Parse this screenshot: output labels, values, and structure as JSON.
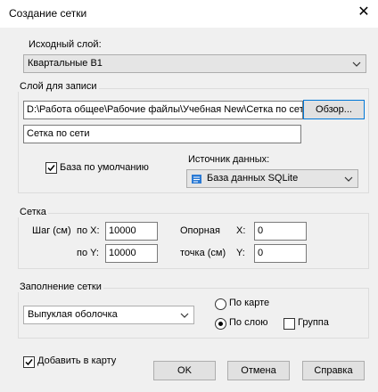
{
  "window": {
    "title": "Создание сетки",
    "close_glyph": "✕"
  },
  "source_layer": {
    "label": "Исходный слой:",
    "value": "Квартальные В1"
  },
  "write_layer": {
    "group_label": "Слой для записи",
    "path": "D:\\Работа общее\\Рабочие файлы\\Учебная New\\Сетка по сет",
    "browse_label": "Обзор...",
    "name": "Сетка по сети",
    "default_db_label": "База по умолчанию",
    "default_db_checked": true,
    "data_source_label": "Источник данных:",
    "data_source_value": "База данных SQLite",
    "data_source_icon": "database-icon"
  },
  "grid": {
    "group_label": "Сетка",
    "step_label": "Шаг (см)",
    "x_label": "по X:",
    "y_label": "по Y:",
    "step_x": "10000",
    "step_y": "10000",
    "ref_label_1": "Опорная",
    "ref_label_2": "точка (см)",
    "ref_x_label": "X:",
    "ref_y_label": "Y:",
    "ref_x": "0",
    "ref_y": "0"
  },
  "fill": {
    "group_label": "Заполнение сетки",
    "value": "Выпуклая оболочка",
    "by_map_label": "По карте",
    "by_layer_label": "По слою",
    "group_check_label": "Группа",
    "selected": "by_layer",
    "group_checked": false
  },
  "footer": {
    "add_to_map_label": "Добавить в карту",
    "add_to_map_checked": true,
    "ok_label": "OK",
    "cancel_label": "Отмена",
    "help_label": "Справка"
  },
  "colors": {
    "focus_border": "#0078d7",
    "db_icon": "#2a7ad5"
  }
}
